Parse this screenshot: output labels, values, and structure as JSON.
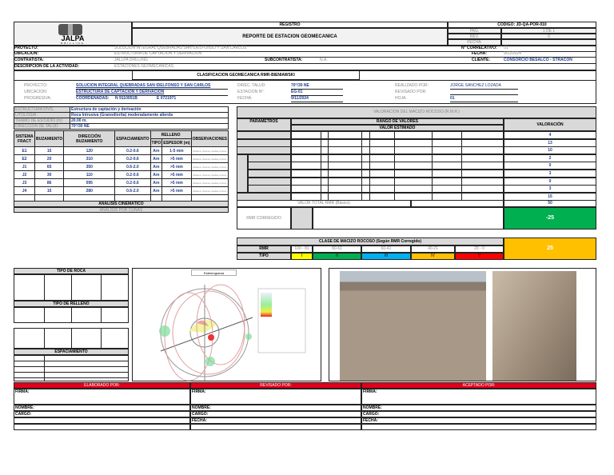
{
  "header": {
    "logo_text": "JALPA",
    "logo_sub": "DRILLING",
    "registro": "REGISTRO",
    "title": "REPORTE DE ESTACION GEOMECANICA",
    "codigo": "CODIGO: JD-QA-POR-010",
    "pag_label": "PAG.",
    "pag": "1 DE 1",
    "rev_label": "REV.",
    "rev": "0",
    "fecha_label": "FECHA:"
  },
  "general": {
    "proyecto_label": "PROYECTO:",
    "proyecto": "SOLUCION INTEGRAL QUEBRADAS SAN IDELFONSO Y SAN CARLOS",
    "ubicacion_label": "UBICACIÓN:",
    "ubicacion": "ESTRUCTURA DE CAPTACIÓN Y DERIVACIÓN",
    "contratista_label": "CONTRATISTA:",
    "contratista": "JALLPA DRILLING",
    "descripcion_label": "DESCRIPCIÓN DE LA ACTIVIDAD:",
    "descripcion": "ESTACIONES GEOMECANICAS",
    "correlativo_label": "N° CORRELATIVO:",
    "correlativo": "01",
    "fecha_label": "FECHA:",
    "fecha": "9/11/2024",
    "subcontratista_label": "SUBCONTRATISTA:",
    "subcontratista": "N.A.",
    "cliente_label": "CLIENTE:",
    "cliente": "CONSORCIO BESALCO - STRACON"
  },
  "clasificacion": "CLASIFICACION GEOMECANICA RMR-BIENIAWSKI",
  "info": {
    "proyecto_label": "PROYECTO:",
    "proyecto": "SOLUCION INTEGRAL QUEBRADAS SAN IDELFONSO Y SAN CARLOS",
    "ubicacion_label": "UBICACIÓN:",
    "ubicacion": "ESTRUCTURA DE CAPTACIÓN Y DERIVACIÓN",
    "progresiva_label": "PROGRESIVA:",
    "coord_label": "COORDENADAS:",
    "coord_n": "N 9110051B",
    "coord_e": "E 0721971",
    "dirtalud_label": "DIREC. TALUD:",
    "dirtalud": "70°/30 NE",
    "estacion_label": "ESTACION N°:",
    "estacion": "EG-01",
    "fecha_label": "FECHA:",
    "fecha": "9/11/2024",
    "realizado_label": "REALIZADO POR:",
    "realizado": "JORGE SANCHEZ LOZADA",
    "revisado_label": "REVISADO POR:",
    "hoja_label": "HOJA:",
    "hoja": "01"
  },
  "estructura": {
    "rows": [
      {
        "label": "ESTRUCTURA DIVS.",
        "value": "Estructura de captación y derivación"
      },
      {
        "label": "LITOLOGIA",
        "value": "Roca Intrusiva (Granodiorita) moderadamente alterda"
      },
      {
        "label": "TRAMO DE ESTUDIO (m)",
        "value": "20.00 m."
      },
      {
        "label": "DIRECCION DE TALUD",
        "value": "70°/30 NE"
      }
    ]
  },
  "disc": {
    "headers": {
      "sistema": "SISTEMA FRACT",
      "buzamiento": "BUZAMIENTO",
      "dir": "DIRECCIÓN BUZAMIENTO",
      "espaciamiento": "ESPACIAMIENTO",
      "relleno": "RELLENO",
      "tipo": "TIPO",
      "espesor": "ESPESOR (m)",
      "obs": "OBSERVACIONES"
    },
    "rows": [
      [
        "E1",
        "15",
        "120",
        "0.2-0.6",
        "Are",
        "1-5 mm",
        "Relleno: Granos medios a finos"
      ],
      [
        "E2",
        "20",
        "310",
        "0.2-0.6",
        "Are",
        ">5 mm",
        "Relleno: Granos medios a finos"
      ],
      [
        "J1",
        "65",
        "350",
        "0.6-2.0",
        "Are",
        ">5 mm",
        "Relleno: Granos medios a finos"
      ],
      [
        "J2",
        "30",
        "110",
        "0.2-0.6",
        "Are",
        ">5 mm",
        "Relleno: Granos medios a finos"
      ],
      [
        "J3",
        "86",
        "095",
        "0.2-0.6",
        "Are",
        ">5 mm",
        "Relleno: Granos medios a finos"
      ],
      [
        "J4",
        "15",
        "280",
        "0.6-2.0",
        "Are",
        ">5 mm",
        "Relleno: Granos medios a finos"
      ]
    ],
    "analisis": "ANÁLISIS CINEMÁTICO",
    "cunas": "ANÁLISIS POR CUÑAS"
  },
  "rmr": {
    "title": "VALORACION DEL MACIZO ROCOSO (R.M.R.)",
    "parametros": "PARAMETROS",
    "rango": "RANGO DE VALORES",
    "estimado": "VALOR ESTIMADO",
    "valoracion": "VALORACIÓN",
    "values": [
      "4",
      "13",
      "10",
      "2",
      "0",
      "3",
      "0",
      "3",
      "15"
    ],
    "total_label": "VALOR TOTAL RMR (Básico)",
    "total": "50",
    "corregido_label": "RMR CORREGIDO",
    "corregido": "-25"
  },
  "clase": {
    "title": "CLASE DE MACIZO ROCOSO (Según RMR Corregido)",
    "rmr_label": "RMR",
    "tipo_label": "TIPO",
    "ranges": [
      "100 - 81",
      "80-61",
      "60-41",
      "40-21",
      "20 - 0"
    ],
    "tipos": [
      "I",
      "II",
      "III",
      "IV",
      "V"
    ],
    "colors": [
      "#ffff00",
      "#00b050",
      "#00b0f0",
      "#ffc000",
      "#ff0000"
    ],
    "result": "25",
    "result_color": "#ffc000"
  },
  "lower": {
    "tipo_roca": "TIPO DE ROCA",
    "tipo_relleno": "TIPO DE RELLENO",
    "espaciamiento": "ESPACIAMIENTO",
    "estereograma": "Estereograma"
  },
  "firmas": [
    {
      "title": "ELABORADO POR:",
      "firma": "FIRMA:",
      "nombre": "NOMBRE:",
      "cargo": "CARGO:"
    },
    {
      "title": "REVISADO POR:",
      "firma": "FIRMA:",
      "nombre": "NOMBRE:",
      "cargo": "CARGO:",
      "fecha": "FECHA:"
    },
    {
      "title": "ACEPTADO POR:",
      "firma": "FIRMA:",
      "nombre": "NOMBRE:",
      "cargo": "CARGO:",
      "fecha": "FECHA:"
    }
  ]
}
